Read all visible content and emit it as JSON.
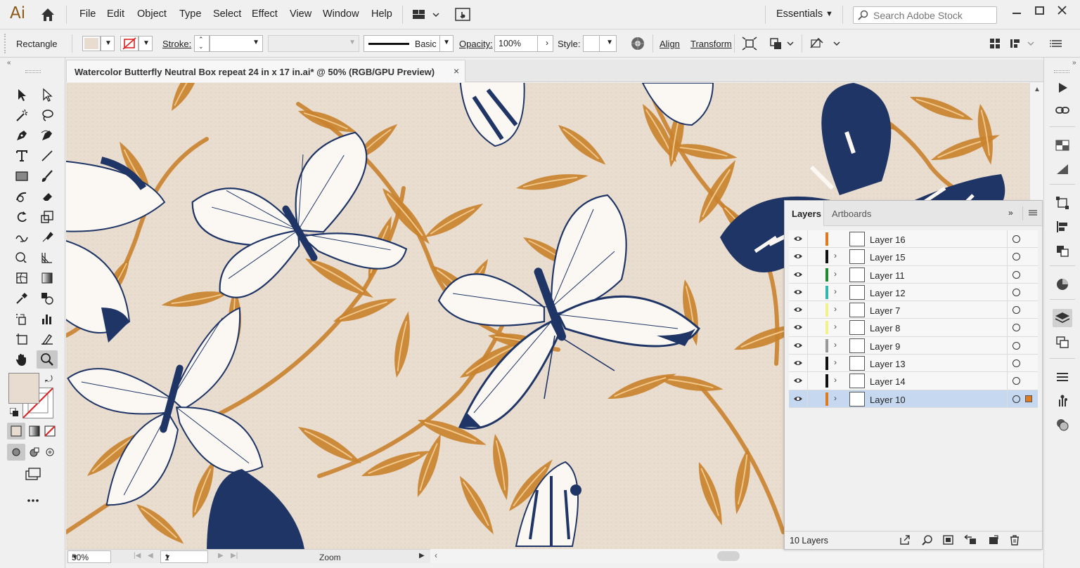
{
  "app": {
    "logo_text": "Ai",
    "menus": [
      "File",
      "Edit",
      "Object",
      "Type",
      "Select",
      "Effect",
      "View",
      "Window",
      "Help"
    ],
    "workspace": "Essentials",
    "search_placeholder": "Search Adobe Stock"
  },
  "controlbar": {
    "selection_type": "Rectangle",
    "stroke_label": "Stroke:",
    "brush_label": "Basic",
    "opacity_label": "Opacity:",
    "opacity_value": "100%",
    "style_label": "Style:",
    "align_label": "Align",
    "transform_label": "Transform",
    "fill_color": "#e8dcd1"
  },
  "document": {
    "tab_title": "Watercolor Butterfly Neutral Box repeat 24 in x 17 in.ai* @ 50% (RGB/GPU Preview)",
    "close_glyph": "×"
  },
  "statusbar": {
    "zoom": "50%",
    "artboard": "1",
    "tool_status": "Zoom"
  },
  "layers_panel": {
    "tabs": [
      "Layers",
      "Artboards"
    ],
    "count_label": "10 Layers",
    "layers": [
      {
        "name": "Layer 16",
        "color": "#e07a1e",
        "expandable": false,
        "selected": false
      },
      {
        "name": "Layer 15",
        "color": "#111111",
        "expandable": true,
        "selected": false
      },
      {
        "name": "Layer 11",
        "color": "#1f8a2e",
        "expandable": true,
        "selected": false
      },
      {
        "name": "Layer 12",
        "color": "#2fb7b0",
        "expandable": true,
        "selected": false
      },
      {
        "name": "Layer 7",
        "color": "#f2f28a",
        "expandable": true,
        "selected": false
      },
      {
        "name": "Layer 8",
        "color": "#f2f28a",
        "expandable": true,
        "selected": false
      },
      {
        "name": "Layer 9",
        "color": "#9a9a9a",
        "expandable": true,
        "selected": false
      },
      {
        "name": "Layer 13",
        "color": "#111111",
        "expandable": true,
        "selected": false
      },
      {
        "name": "Layer 14",
        "color": "#111111",
        "expandable": true,
        "selected": false
      },
      {
        "name": "Layer 10",
        "color": "#e07a1e",
        "expandable": true,
        "selected": true
      }
    ]
  },
  "colors": {
    "canvas_bg": "#e9ddd0",
    "leaf": "#c9822e",
    "butterfly_navy": "#1f3566",
    "butterfly_white": "#fbf8f3",
    "selection": "#c5d8f0"
  }
}
